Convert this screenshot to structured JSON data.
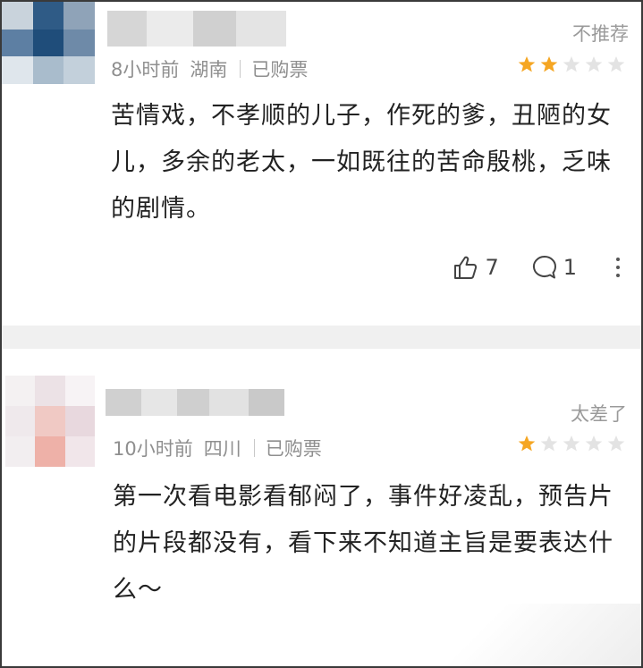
{
  "reviews": [
    {
      "tag": "不推荐",
      "time": "8小时前",
      "location": "湖南",
      "ticket": "已购票",
      "rating": 2,
      "max_rating": 5,
      "content": "苦情戏，不孝顺的儿子，作死的爹，丑陋的女儿，多余的老太，一如既往的苦命殷桃，乏味的剧情。",
      "likes": "7",
      "comments": "1"
    },
    {
      "tag": "太差了",
      "time": "10小时前",
      "location": "四川",
      "ticket": "已购票",
      "rating": 1,
      "max_rating": 5,
      "content": "第一次看电影看郁闷了，事件好凌乱，预告片的片段都没有，看下来不知道主旨是要表达什么～"
    }
  ],
  "colors": {
    "star_filled": "#f5a623",
    "star_empty": "#e3e3e3",
    "meta_text": "#8f8f8f",
    "body_text": "#222222",
    "divider": "#f0f0f0"
  },
  "icons": {
    "like": "thumbs-up-icon",
    "comment": "comment-bubble-icon",
    "more": "more-vertical-icon"
  }
}
